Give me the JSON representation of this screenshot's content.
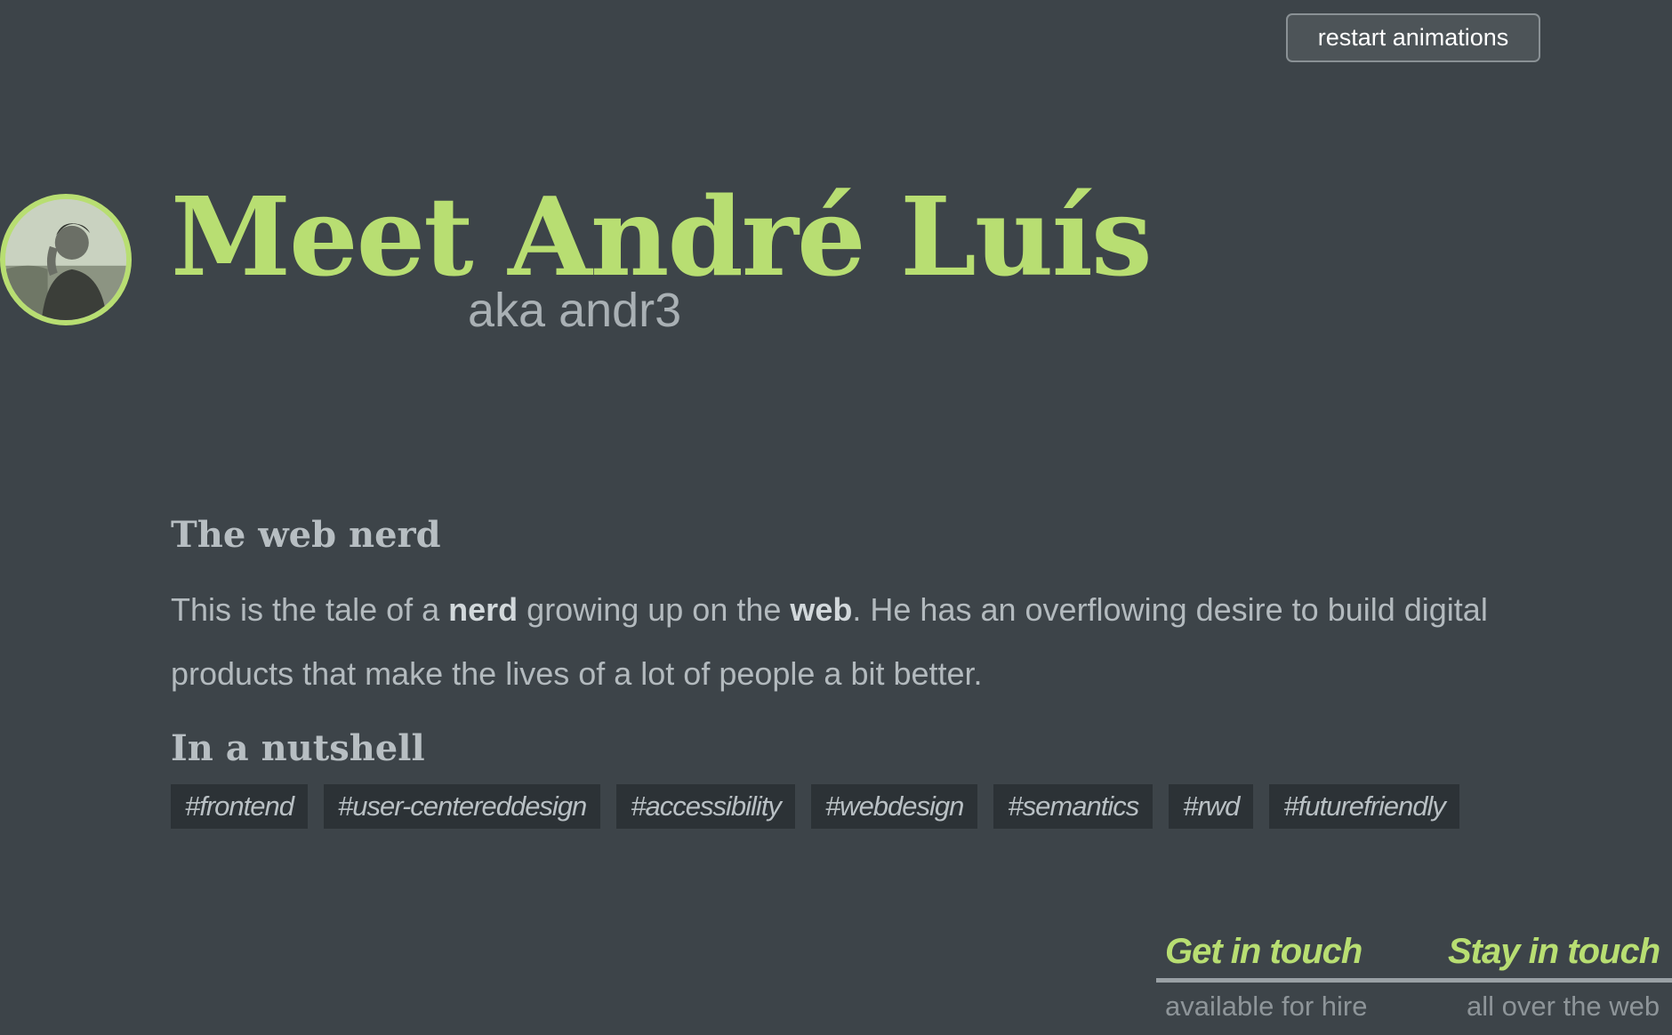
{
  "header": {
    "restart_label": "restart animations"
  },
  "hero": {
    "title": "Meet André Luís",
    "subtitle": "aka andr3",
    "avatar_icon": "person-photo"
  },
  "about": {
    "heading": "The web nerd",
    "bio": {
      "part1": "This is the tale of a ",
      "bold1": "nerd",
      "part2": " growing up on the ",
      "bold2": "web",
      "part3": ". He has an overflowing desire to build digital products that make the lives of a lot of people a bit better."
    }
  },
  "nutshell": {
    "heading": "In a nutshell",
    "tags": [
      "#frontend",
      "#user-centereddesign",
      "#accessibility",
      "#webdesign",
      "#semantics",
      "#rwd",
      "#futurefriendly"
    ]
  },
  "footer": {
    "get_in_touch": {
      "label": "Get in touch",
      "sub": "available for hire"
    },
    "stay_in_touch": {
      "label": "Stay in touch",
      "sub": "all over the web"
    }
  },
  "colors": {
    "background": "#3d4449",
    "accent": "#b8de72",
    "tag_background": "#2c3236"
  }
}
